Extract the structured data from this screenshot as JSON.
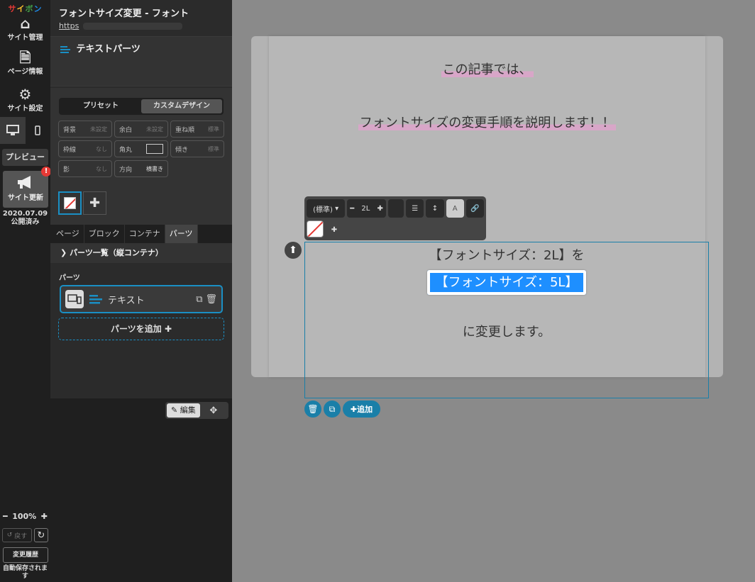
{
  "rail": {
    "logo": [
      "サ",
      "イ",
      "ボ",
      "ン"
    ],
    "site_manage": "サイト管理",
    "page_info": "ページ情報",
    "site_settings": "サイト設定",
    "preview": "プレビュー",
    "site_update": "サイト更新",
    "update_badge": "!",
    "publish_date": "2020.07.09",
    "publish_status": "公開済み",
    "zoom": "100%",
    "undo": "戻す",
    "history": "変更履歴",
    "autosave": "自動保存されます"
  },
  "panel": {
    "page_title": "フォントサイズ変更 - フォント",
    "url_prefix": "https",
    "part_title": "テキストパーツ",
    "seg_preset": "プリセット",
    "seg_custom": "カスタムデザイン",
    "props": [
      {
        "label": "背景",
        "value": "未設定"
      },
      {
        "label": "余白",
        "value": "未設定"
      },
      {
        "label": "重ね順",
        "value": "標準"
      },
      {
        "label": "枠線",
        "value": "なし"
      },
      {
        "label": "角丸",
        "value": ""
      },
      {
        "label": "傾き",
        "value": "標準"
      },
      {
        "label": "影",
        "value": "なし"
      },
      {
        "label": "方向",
        "value": "横書き"
      }
    ],
    "tabs": [
      "ページ",
      "ブロック",
      "コンテナ",
      "パーツ"
    ],
    "list_header": "パーツ一覧（縦コンテナ）",
    "parts_label": "パーツ",
    "part_item": "テキスト",
    "add_part": "パーツを追加",
    "edit": "編集"
  },
  "canvas": {
    "line1": "この記事では、",
    "line2": "フォントサイズの変更手順を説明します！！",
    "toolbar": {
      "style": "(標準)",
      "size": "2L",
      "color_letter": "A"
    },
    "sel_line1": "【フォントサイズ：2L】を",
    "sel_line2": "【フォントサイズ：5L】",
    "sel_line3": "に変更します。",
    "add_label": "追加"
  },
  "colors": {
    "accent": "#1a8fc4",
    "highlight": "#1e8fff",
    "marker": "#d8a6c8"
  }
}
